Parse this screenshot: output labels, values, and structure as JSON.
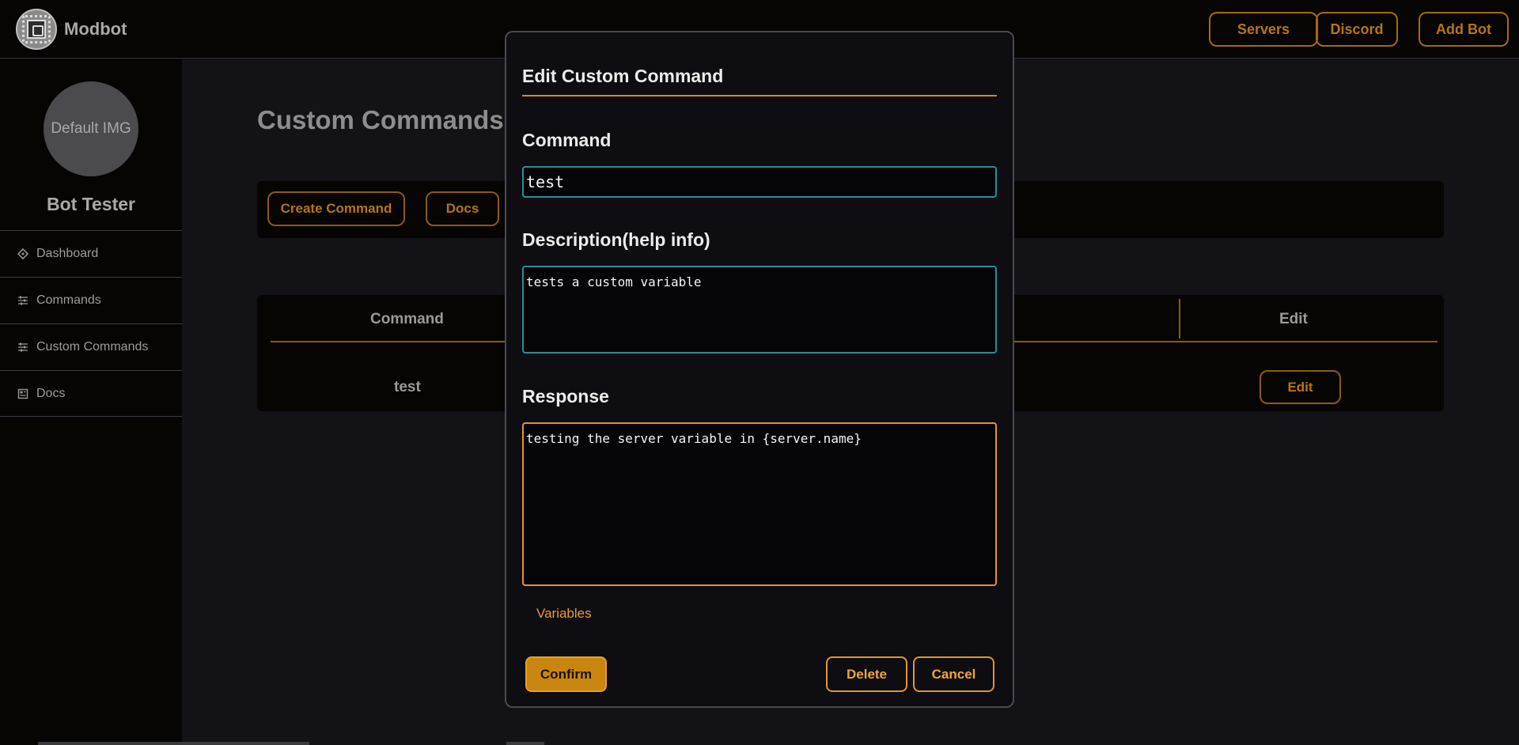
{
  "header": {
    "brand": "Modbot",
    "nav": [
      "Servers",
      "Discord",
      "Add Bot"
    ]
  },
  "sidebar": {
    "avatar_text": "Default IMG",
    "bot_name": "Bot Tester",
    "items": [
      {
        "label": "Dashboard",
        "icon": "dashboard-icon"
      },
      {
        "label": "Commands",
        "icon": "sliders-icon"
      },
      {
        "label": "Custom Commands",
        "icon": "sliders-icon"
      },
      {
        "label": "Docs",
        "icon": "docs-icon"
      }
    ]
  },
  "main": {
    "title": "Custom Commands",
    "toolbar": {
      "create_label": "Create Command",
      "docs_label": "Docs"
    },
    "table": {
      "headers": {
        "command": "Command",
        "edit": "Edit"
      },
      "rows": [
        {
          "command": "test",
          "edit_label": "Edit"
        }
      ]
    }
  },
  "modal": {
    "title": "Edit Custom Command",
    "command_label": "Command",
    "command_value": "test",
    "description_label": "Description(help info)",
    "description_value": "tests a custom variable",
    "response_label": "Response",
    "response_value": "testing the server variable in {server.name}",
    "variables_link": "Variables",
    "confirm_label": "Confirm",
    "delete_label": "Delete",
    "cancel_label": "Cancel"
  },
  "colors": {
    "accent": "#e3952f",
    "accent_dark": "#8d5a10",
    "focus": "#2a8f97",
    "background": "#121217",
    "panel": "#060504"
  }
}
